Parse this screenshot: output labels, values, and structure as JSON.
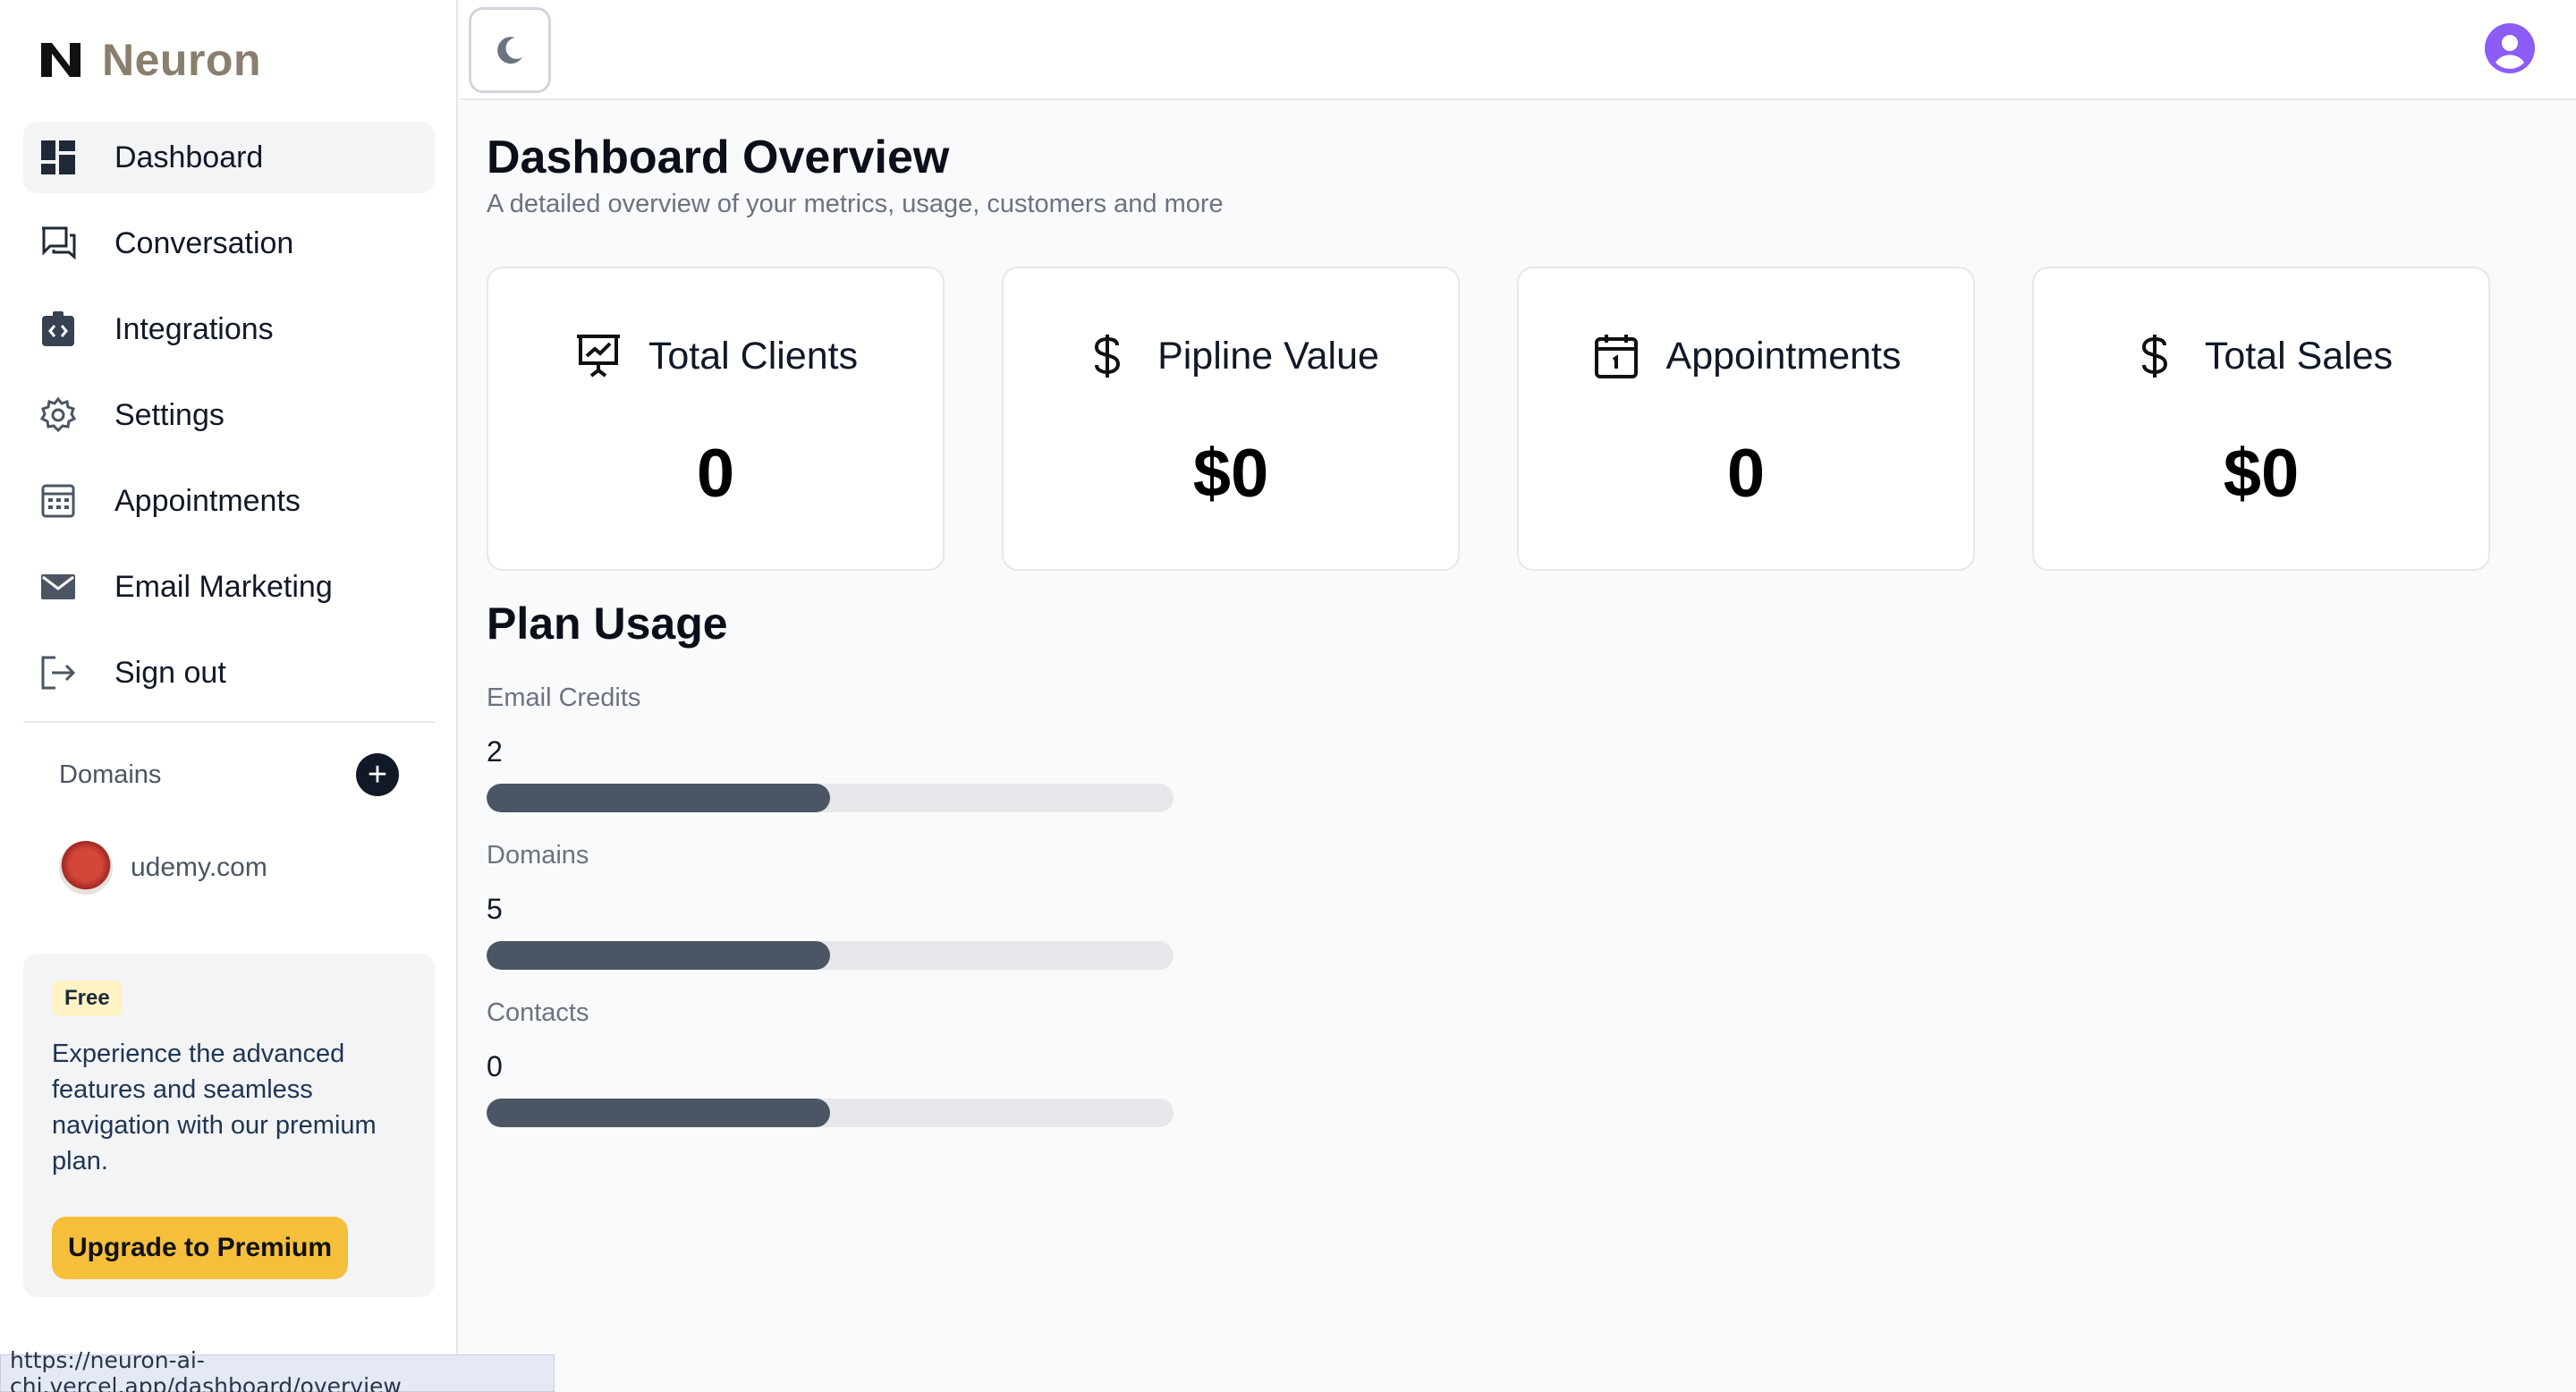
{
  "brand": {
    "name": "Neuron"
  },
  "sidebar": {
    "items": [
      {
        "label": "Dashboard",
        "icon": "dashboard-icon",
        "active": true
      },
      {
        "label": "Conversation",
        "icon": "chat-icon",
        "active": false
      },
      {
        "label": "Integrations",
        "icon": "integrations-icon",
        "active": false
      },
      {
        "label": "Settings",
        "icon": "gear-icon",
        "active": false
      },
      {
        "label": "Appointments",
        "icon": "calendar-grid-icon",
        "active": false
      },
      {
        "label": "Email Marketing",
        "icon": "mail-icon",
        "active": false
      },
      {
        "label": "Sign out",
        "icon": "sign-out-icon",
        "active": false
      }
    ],
    "domains_title": "Domains",
    "add_symbol": "+",
    "domains": [
      {
        "name": "udemy.com"
      }
    ],
    "promo": {
      "badge": "Free",
      "text": "Experience the advanced features and seamless navigation with our premium plan.",
      "button": "Upgrade to Premium"
    }
  },
  "main": {
    "title": "Dashboard Overview",
    "subtitle": "A detailed overview of your metrics, usage, customers and more",
    "cards": [
      {
        "label": "Total Clients",
        "value": "0",
        "icon": "presentation-chart-icon"
      },
      {
        "label": "Pipline Value",
        "value": "$0",
        "icon": "dollar-icon"
      },
      {
        "label": "Appointments",
        "value": "0",
        "icon": "calendar-icon"
      },
      {
        "label": "Total Sales",
        "value": "$0",
        "icon": "dollar-icon"
      }
    ],
    "plan_usage": {
      "title": "Plan Usage",
      "items": [
        {
          "label": "Email Credits",
          "count": "2",
          "fill_fraction": 0.5
        },
        {
          "label": "Domains",
          "count": "5",
          "fill_fraction": 0.5
        },
        {
          "label": "Contacts",
          "count": "0",
          "fill_fraction": 0.5
        }
      ]
    }
  },
  "status_bar": {
    "url": "https://neuron-ai-chi.vercel.app/dashboard/overview"
  },
  "colors": {
    "accent_brand": "#8a7e6e",
    "upgrade_button": "#f5bf3c",
    "avatar": "#8b5cf6",
    "bar_fill": "#4b5563"
  }
}
